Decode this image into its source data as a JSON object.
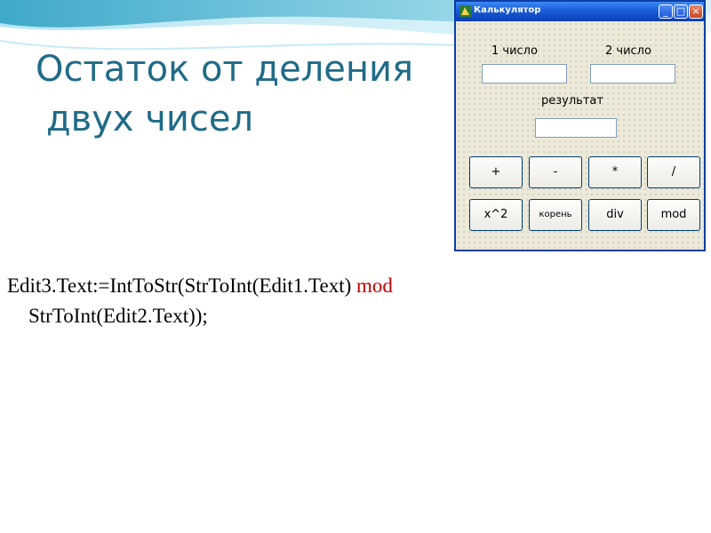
{
  "slide": {
    "title_line1": "Остаток от деления",
    "title_line2": "двух чисел"
  },
  "window": {
    "title": "Калькулятор",
    "controls": {
      "minimize": "_",
      "maximize": "□",
      "close": "×"
    },
    "label_first": "1 число",
    "label_second": "2 число",
    "label_result": "результат",
    "edit1_value": "",
    "edit2_value": "",
    "edit3_value": "",
    "buttons": {
      "plus": "+",
      "minus": "-",
      "multiply": "*",
      "divide": "/",
      "square": "x^2",
      "root": "корень",
      "div": "div",
      "mod": "mod"
    }
  },
  "code": {
    "line1_prefix": "Edit3.Text:=IntToStr(StrToInt(Edit1.Text) ",
    "keyword": "mod",
    "line2": "StrToInt(Edit2.Text));"
  },
  "colors": {
    "title": "#1f6b87",
    "keyword": "#c00000",
    "titlebar": "#1a5cd8"
  }
}
